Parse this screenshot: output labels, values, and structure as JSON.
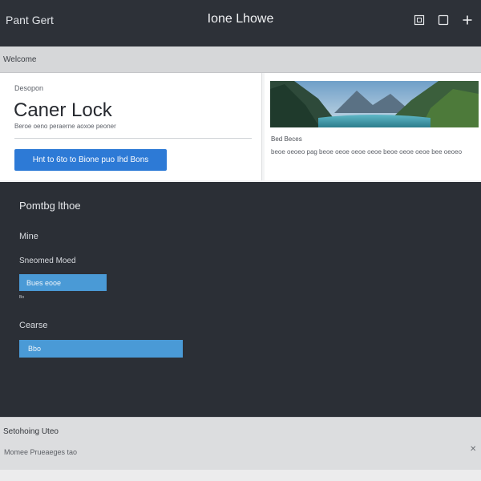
{
  "titlebar": {
    "app_name": "Pant Gert",
    "window_title": "Ione Lhowe",
    "icons": [
      "restore-icon",
      "maximize-icon",
      "plus-icon"
    ]
  },
  "section_bar": {
    "label": "Welcome"
  },
  "card_left": {
    "eyebrow": "Desopon",
    "headline": "Caner Lock",
    "subtext": "Beroe oeno peraerne aoxoe peoner",
    "button_label": "Hnt to 6to to Bione puo Ihd Bons"
  },
  "card_right": {
    "image": "landscape-mountain-lake",
    "caption_title": "Bed Beces",
    "caption_body": "beoe oeoeo pag beoe oeoe oeoe oeoe beoe oeoe oeoe bee oeoeo"
  },
  "form": {
    "title": "Pomtbg lthoe",
    "label_1": "Mine",
    "label_2": "Sneomed Moed",
    "field_1_value": "Bues eooe",
    "hint": "Bo",
    "label_3": "Cearse",
    "field_2_value": "Bbo"
  },
  "notification": {
    "title": "Setohoing Uteo",
    "body": "Momee Prueaeges tao",
    "close_icon": "close-icon"
  },
  "colors": {
    "titlebar_bg": "#2d3138",
    "dark_bg": "#2b2f36",
    "primary_button": "#2d7ad6",
    "field_fill": "#4a9ad6",
    "section_bar_bg": "#d6d7d9"
  }
}
